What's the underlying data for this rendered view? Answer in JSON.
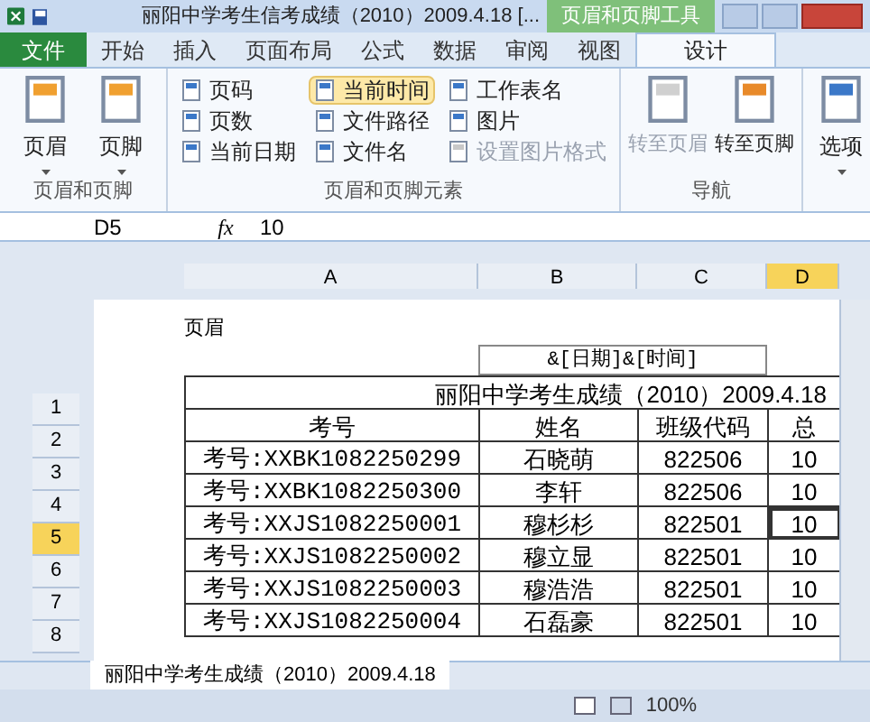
{
  "window": {
    "title": "丽阳中学考生信考成绩（2010）2009.4.18 [..."
  },
  "context_tab": {
    "label": "页眉和页脚工具"
  },
  "tabs": [
    {
      "label": "文件",
      "kind": "file",
      "selected": false
    },
    {
      "label": "开始",
      "kind": "tab",
      "selected": false
    },
    {
      "label": "插入",
      "kind": "tab",
      "selected": false
    },
    {
      "label": "页面布局",
      "kind": "tab",
      "selected": false
    },
    {
      "label": "公式",
      "kind": "tab",
      "selected": false
    },
    {
      "label": "数据",
      "kind": "tab",
      "selected": false
    },
    {
      "label": "审阅",
      "kind": "tab",
      "selected": false
    },
    {
      "label": "视图",
      "kind": "tab",
      "selected": false
    },
    {
      "label": "设计",
      "kind": "tab",
      "selected": true
    }
  ],
  "ribbon": {
    "groups": [
      {
        "label": "页眉和页脚",
        "kind": "large",
        "buttons": [
          {
            "label": "页眉",
            "disabled": false
          },
          {
            "label": "页脚",
            "disabled": false
          }
        ]
      },
      {
        "label": "页眉和页脚元素",
        "kind": "small",
        "buttons": [
          {
            "label": "页码",
            "disabled": false,
            "hovered": false
          },
          {
            "label": "页数",
            "disabled": false,
            "hovered": false
          },
          {
            "label": "当前日期",
            "disabled": false,
            "hovered": false
          },
          {
            "label": "当前时间",
            "disabled": false,
            "hovered": true
          },
          {
            "label": "文件路径",
            "disabled": false,
            "hovered": false
          },
          {
            "label": "文件名",
            "disabled": false,
            "hovered": false
          },
          {
            "label": "工作表名",
            "disabled": false,
            "hovered": false
          },
          {
            "label": "图片",
            "disabled": false,
            "hovered": false
          },
          {
            "label": "设置图片格式",
            "disabled": true,
            "hovered": false
          }
        ]
      },
      {
        "label": "导航",
        "kind": "nav",
        "buttons": [
          {
            "label": "转至页眉",
            "disabled": true
          },
          {
            "label": "转至页脚",
            "disabled": false
          }
        ]
      },
      {
        "kind": "options",
        "buttons": [
          {
            "label": "选项",
            "disabled": false
          }
        ]
      }
    ]
  },
  "formula_bar": {
    "name_box": "D5",
    "function_label": "fx",
    "value": "10"
  },
  "columns": [
    {
      "label": "A",
      "selected": false
    },
    {
      "label": "B",
      "selected": false
    },
    {
      "label": "C",
      "selected": false
    },
    {
      "label": "D",
      "selected": true
    }
  ],
  "page": {
    "header_label": "页眉",
    "header_field": "&[日期]&[时间]"
  },
  "rows": [
    {
      "number": "1",
      "kind": "title",
      "selected": false,
      "cells": [
        "丽阳中学考生成绩（2010）2009.4.18"
      ]
    },
    {
      "number": "2",
      "kind": "header",
      "selected": false,
      "cells": [
        "考号",
        "姓名",
        "班级代码",
        "总"
      ]
    },
    {
      "number": "3",
      "kind": "data",
      "selected": false,
      "cells": [
        "考号:XXBK1082250299",
        "石晓萌",
        "822506",
        "10"
      ]
    },
    {
      "number": "4",
      "kind": "data",
      "selected": false,
      "cells": [
        "考号:XXBK1082250300",
        "李轩",
        "822506",
        "10"
      ]
    },
    {
      "number": "5",
      "kind": "data",
      "selected": true,
      "cells": [
        "考号:XXJS1082250001",
        "穆杉杉",
        "822501",
        "10"
      ]
    },
    {
      "number": "6",
      "kind": "data",
      "selected": false,
      "cells": [
        "考号:XXJS1082250002",
        "穆立显",
        "822501",
        "10"
      ]
    },
    {
      "number": "7",
      "kind": "data",
      "selected": false,
      "cells": [
        "考号:XXJS1082250003",
        "穆浩浩",
        "822501",
        "10"
      ]
    },
    {
      "number": "8",
      "kind": "data",
      "selected": false,
      "cells": [
        "考号:XXJS1082250004",
        "石磊豪",
        "822501",
        "10"
      ]
    }
  ],
  "sheet_tab": {
    "label": "丽阳中学考生成绩（2010）2009.4.18"
  },
  "status_bar": {
    "zoom": "100%"
  }
}
